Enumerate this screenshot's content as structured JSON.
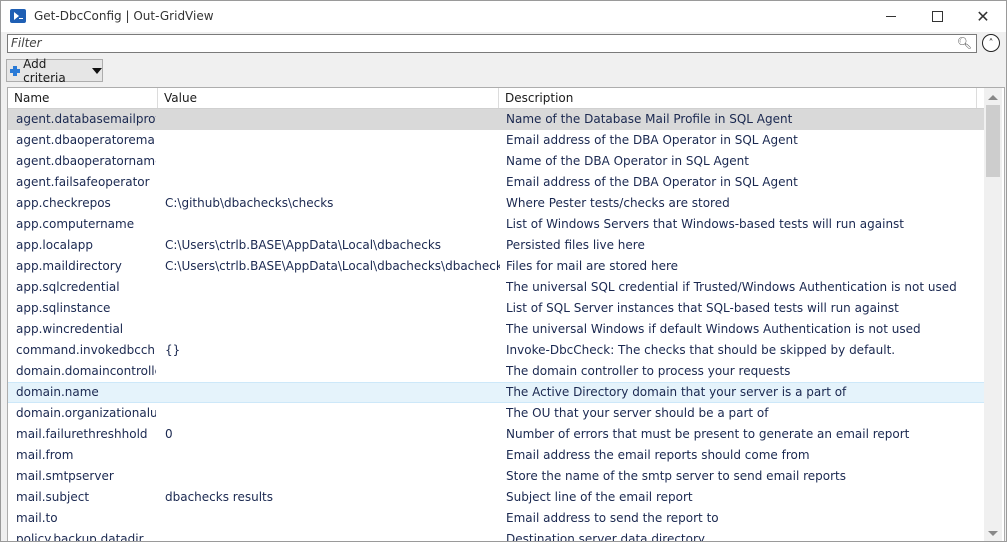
{
  "window": {
    "title": "Get-DbcConfig | Out-GridView"
  },
  "filter": {
    "placeholder": "Filter"
  },
  "toolbar": {
    "add_criteria_label": "Add criteria"
  },
  "columns": [
    "Name",
    "Value",
    "Description"
  ],
  "rows": [
    {
      "name": "agent.databasemailprofile",
      "value": "",
      "description": "Name of the Database Mail Profile in SQL Agent"
    },
    {
      "name": "agent.dbaoperatoremail",
      "value": "",
      "description": "Email address of the DBA Operator in SQL Agent"
    },
    {
      "name": "agent.dbaoperatorname",
      "value": "",
      "description": "Name of the DBA Operator in SQL Agent"
    },
    {
      "name": "agent.failsafeoperator",
      "value": "",
      "description": "Email address of the DBA Operator in SQL Agent"
    },
    {
      "name": "app.checkrepos",
      "value": "C:\\github\\dbachecks\\checks",
      "description": "Where Pester tests/checks are stored"
    },
    {
      "name": "app.computername",
      "value": "",
      "description": "List of Windows Servers that Windows-based tests will run against"
    },
    {
      "name": "app.localapp",
      "value": "C:\\Users\\ctrlb.BASE\\AppData\\Local\\dbachecks",
      "description": "Persisted files live here"
    },
    {
      "name": "app.maildirectory",
      "value": "C:\\Users\\ctrlb.BASE\\AppData\\Local\\dbachecks\\dbachecks.mail",
      "description": "Files for mail are stored here"
    },
    {
      "name": "app.sqlcredential",
      "value": "",
      "description": "The universal SQL credential if Trusted/Windows Authentication is not used"
    },
    {
      "name": "app.sqlinstance",
      "value": "",
      "description": "List of SQL Server instances that SQL-based tests will run against"
    },
    {
      "name": "app.wincredential",
      "value": "",
      "description": "The universal Windows if default Windows Authentication is not used"
    },
    {
      "name": "command.invokedbcch...",
      "value": "{}",
      "description": "Invoke-DbcCheck: The checks that should be skipped by default."
    },
    {
      "name": "domain.domaincontroller",
      "value": "",
      "description": "The domain controller to process your requests"
    },
    {
      "name": "domain.name",
      "value": "",
      "description": "The Active Directory domain that your server is a part of"
    },
    {
      "name": "domain.organizationalu...",
      "value": "",
      "description": "The OU that your server should be a part of"
    },
    {
      "name": "mail.failurethreshhold",
      "value": "0",
      "description": "Number of errors that must be present to generate an email report"
    },
    {
      "name": "mail.from",
      "value": "",
      "description": "Email address the email reports should come from"
    },
    {
      "name": "mail.smtpserver",
      "value": "",
      "description": "Store the name of the smtp server to send email reports"
    },
    {
      "name": "mail.subject",
      "value": "dbachecks results",
      "description": "Subject line of the email report"
    },
    {
      "name": "mail.to",
      "value": "",
      "description": "Email address to send the report to"
    },
    {
      "name": "policy.backup.datadir",
      "value": "",
      "description": "Destination server data directory"
    }
  ],
  "selected_row": 0,
  "hover_row": 13
}
